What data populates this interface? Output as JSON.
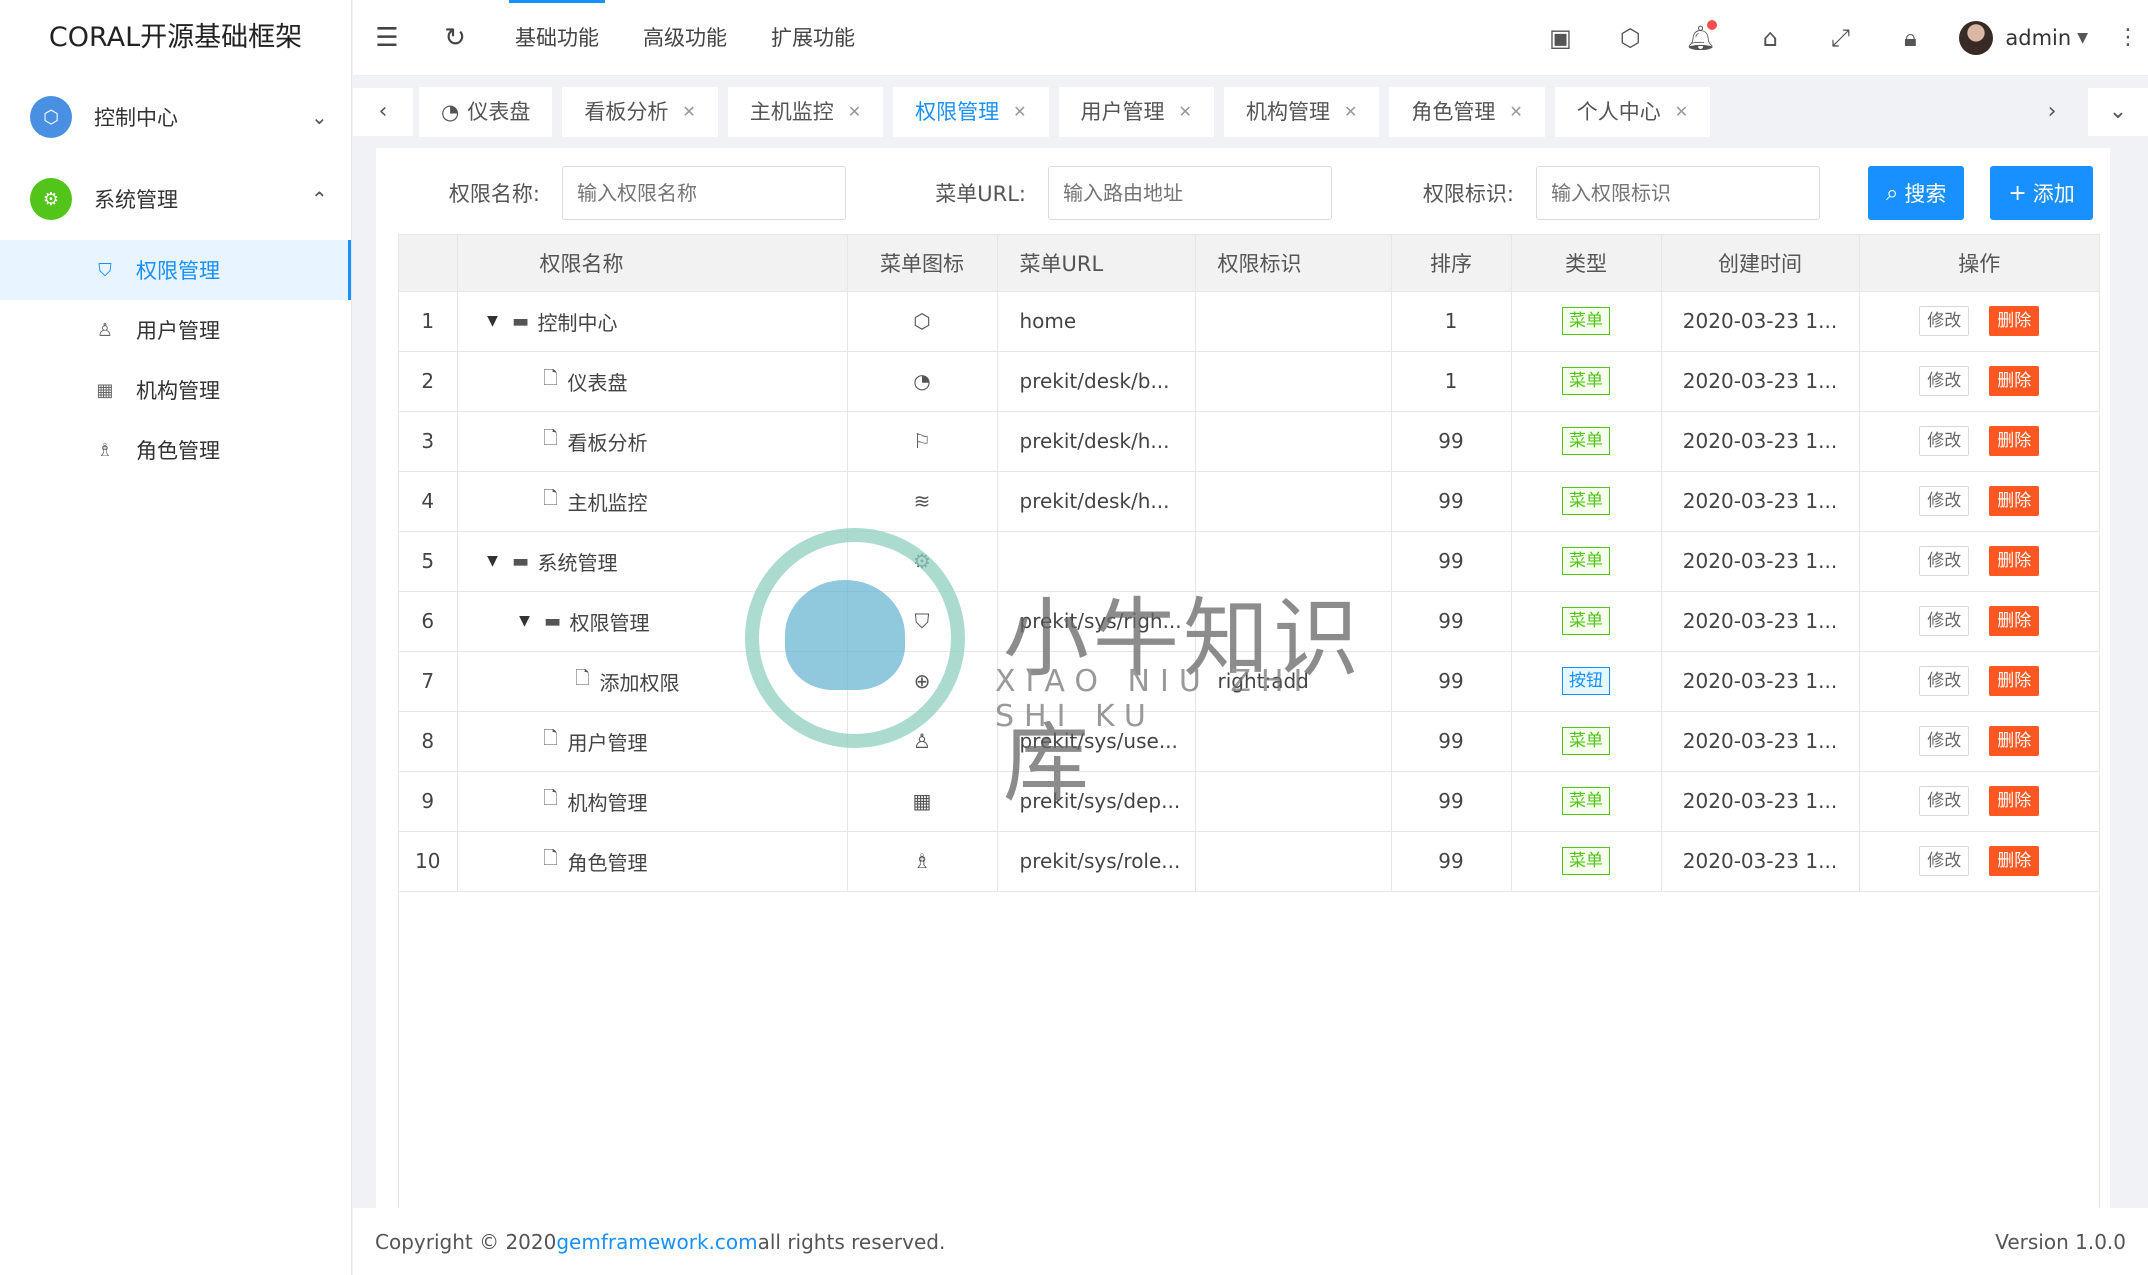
{
  "app": {
    "title": "CORAL开源基础框架"
  },
  "sidebar": {
    "groups": [
      {
        "label": "控制中心",
        "icon": "cube-icon",
        "color": "#4a90e2"
      },
      {
        "label": "系统管理",
        "icon": "gear-icon",
        "color": "#52c41a"
      }
    ],
    "items": [
      {
        "label": "权限管理",
        "icon": "shield-icon"
      },
      {
        "label": "用户管理",
        "icon": "user-icon"
      },
      {
        "label": "机构管理",
        "icon": "calendar-icon"
      },
      {
        "label": "角色管理",
        "icon": "users-icon"
      }
    ]
  },
  "header": {
    "nav": [
      "基础功能",
      "高级功能",
      "扩展功能"
    ],
    "user": "admin"
  },
  "tabs": [
    "仪表盘",
    "看板分析",
    "主机监控",
    "权限管理",
    "用户管理",
    "机构管理",
    "角色管理",
    "个人中心"
  ],
  "search": {
    "name_label": "权限名称:",
    "name_placeholder": "输入权限名称",
    "url_label": "菜单URL:",
    "url_placeholder": "输入路由地址",
    "key_label": "权限标识:",
    "key_placeholder": "输入权限标识",
    "search_btn": "搜索",
    "add_btn": "添加"
  },
  "table": {
    "headers": [
      "",
      "权限名称",
      "菜单图标",
      "菜单URL",
      "权限标识",
      "排序",
      "类型",
      "创建时间",
      "操作"
    ],
    "edit_label": "修改",
    "delete_label": "删除",
    "rows": [
      {
        "no": "1",
        "name": "控制中心",
        "url": "home",
        "perm": "",
        "sort": "1",
        "type": "菜单",
        "time": "2020-03-23 1..."
      },
      {
        "no": "2",
        "name": "仪表盘",
        "url": "prekit/desk/b...",
        "perm": "",
        "sort": "1",
        "type": "菜单",
        "time": "2020-03-23 1..."
      },
      {
        "no": "3",
        "name": "看板分析",
        "url": "prekit/desk/h...",
        "perm": "",
        "sort": "99",
        "type": "菜单",
        "time": "2020-03-23 1..."
      },
      {
        "no": "4",
        "name": "主机监控",
        "url": "prekit/desk/h...",
        "perm": "",
        "sort": "99",
        "type": "菜单",
        "time": "2020-03-23 1..."
      },
      {
        "no": "5",
        "name": "系统管理",
        "url": "",
        "perm": "",
        "sort": "99",
        "type": "菜单",
        "time": "2020-03-23 1..."
      },
      {
        "no": "6",
        "name": "权限管理",
        "url": "prekit/sys/righ...",
        "perm": "",
        "sort": "99",
        "type": "菜单",
        "time": "2020-03-23 1..."
      },
      {
        "no": "7",
        "name": "添加权限",
        "url": "",
        "perm": "right:add",
        "sort": "99",
        "type": "按钮",
        "time": "2020-03-23 1..."
      },
      {
        "no": "8",
        "name": "用户管理",
        "url": "prekit/sys/use...",
        "perm": "",
        "sort": "99",
        "type": "菜单",
        "time": "2020-03-23 1..."
      },
      {
        "no": "9",
        "name": "机构管理",
        "url": "prekit/sys/dep...",
        "perm": "",
        "sort": "99",
        "type": "菜单",
        "time": "2020-03-23 1..."
      },
      {
        "no": "10",
        "name": "角色管理",
        "url": "prekit/sys/role...",
        "perm": "",
        "sort": "99",
        "type": "菜单",
        "time": "2020-03-23 1..."
      }
    ]
  },
  "footer": {
    "prefix": "Copyright © 2020 ",
    "link": "gemframework.com",
    "suffix": " all rights reserved.",
    "version": "Version 1.0.0"
  },
  "watermark": {
    "title": "小牛知识库",
    "subtitle": "XIAO NIU ZHI SHI KU"
  },
  "colors": {
    "accent": "#1890ff",
    "danger": "#ff5722",
    "success": "#52c41a"
  }
}
